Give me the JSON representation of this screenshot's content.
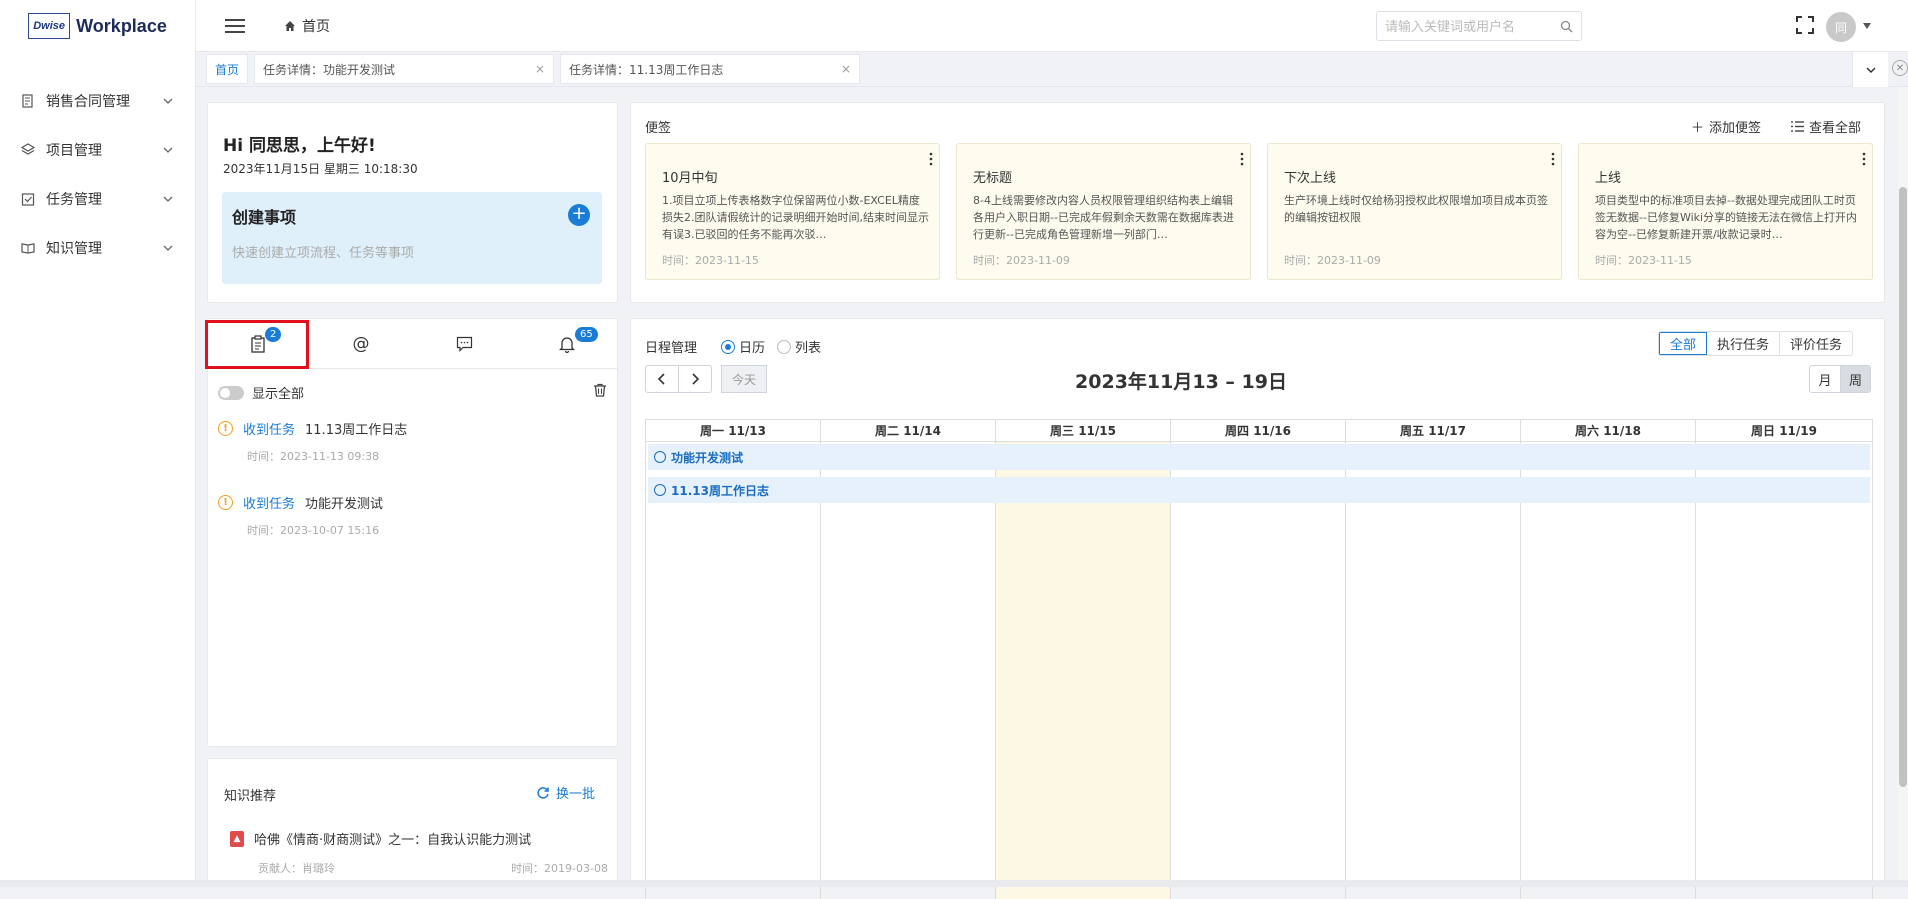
{
  "sidebar": {
    "logo_badge": "Dwise",
    "logo_text": "Workplace",
    "items": [
      {
        "label": "销售合同管理",
        "icon": "contract-icon"
      },
      {
        "label": "项目管理",
        "icon": "layers-icon"
      },
      {
        "label": "任务管理",
        "icon": "task-check-icon"
      },
      {
        "label": "知识管理",
        "icon": "book-icon"
      }
    ]
  },
  "header": {
    "breadcrumb": "首页",
    "search_placeholder": "请输入关键词或用户名",
    "avatar_text": "同"
  },
  "tabs": [
    {
      "label": "首页",
      "active": true
    },
    {
      "label": "任务详情：功能开发测试",
      "close": "×"
    },
    {
      "label": "任务详情：11.13周工作日志",
      "close": "×"
    }
  ],
  "greeting": {
    "title": "Hi 同思思，上午好!",
    "date": "2023年11月15日   星期三   10:18:30",
    "create_title": "创建事项",
    "create_sub": "快速创建立项流程、任务等事项",
    "create_plus": "+"
  },
  "notes": {
    "heading": "便签",
    "add_label": "添加便签",
    "view_all_label": "查看全部",
    "items": [
      {
        "title": "10月中旬",
        "body": "1.项目立项上传表格数字位保留两位小数-EXCEL精度损失2.团队请假统计的记录明细开始时间,结束时间显示有误3.已驳回的任务不能再次驳…",
        "time": "时间：2023-11-15"
      },
      {
        "title": "无标题",
        "body": "8-4上线需要修改内容人员权限管理组织结构表上编辑各用户入职日期--已完成年假剩余天数需在数据库表进行更新--已完成角色管理新增一列部门…",
        "time": "时间：2023-11-09"
      },
      {
        "title": "下次上线",
        "body": "生产环境上线时仅给杨羽授权此权限增加项目成本页签的编辑按钮权限",
        "time": "时间：2023-11-09"
      },
      {
        "title": "上线",
        "body": "项目类型中的标准项目去掉--数据处理完成团队工时页签无数据--已修复Wiki分享的链接无法在微信上打开内容为空--已修复新建开票/收款记录时…",
        "time": "时间：2023-11-15"
      }
    ]
  },
  "messages": {
    "tabs": [
      {
        "icon": "clipboard-icon",
        "badge": "2"
      },
      {
        "icon": "at-icon",
        "badge": ""
      },
      {
        "icon": "comment-icon",
        "badge": ""
      },
      {
        "icon": "bell-icon",
        "badge": "65"
      }
    ],
    "show_all_label": "显示全部",
    "items": [
      {
        "type": "收到任务",
        "title": "11.13周工作日志",
        "time": "时间：2023-11-13 09:38"
      },
      {
        "type": "收到任务",
        "title": "功能开发测试",
        "time": "时间：2023-10-07 15:16"
      }
    ]
  },
  "knowledge": {
    "heading": "知识推荐",
    "refresh_label": "换一批",
    "item_title": "哈佛《情商·财商测试》之一：自我认识能力测试",
    "contributor": "贡献人：肖璐玲",
    "time": "时间：2019-03-08"
  },
  "schedule": {
    "heading": "日程管理",
    "view_options": [
      {
        "label": "日历",
        "selected": true
      },
      {
        "label": "列表",
        "selected": false
      }
    ],
    "filters": [
      {
        "label": "全部",
        "active": true
      },
      {
        "label": "执行任务"
      },
      {
        "label": "评价任务"
      }
    ],
    "today_label": "今天",
    "title": "2023年11月13 – 19日",
    "range_options": [
      {
        "label": "月"
      },
      {
        "label": "周",
        "active": true
      }
    ],
    "days": [
      "周一 11/13",
      "周二 11/14",
      "周三 11/15",
      "周四 11/16",
      "周五 11/17",
      "周六 11/18",
      "周日 11/19"
    ],
    "today_index": 2,
    "events": [
      "功能开发测试",
      "11.13周工作日志"
    ]
  },
  "colors": {
    "accent": "#1a7cd6",
    "highlight_box": "#e0101c",
    "today_bg": "#fcf8e3",
    "note_bg": "#fefbef"
  }
}
